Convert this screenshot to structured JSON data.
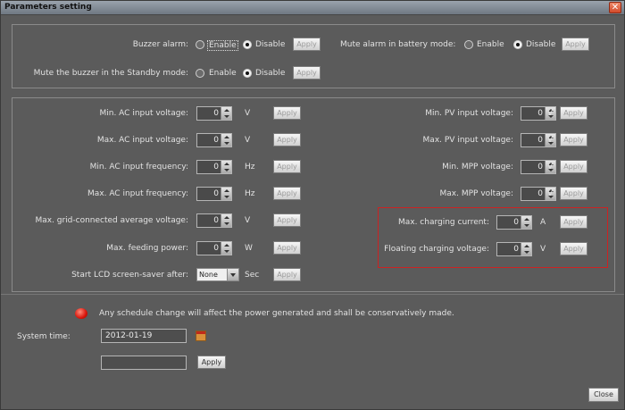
{
  "window": {
    "title": "Parameters setting"
  },
  "top": {
    "buzzer_alarm": {
      "label": "Buzzer alarm:",
      "enable": "Enable",
      "disable": "Disable",
      "apply": "Apply",
      "selected": "enable"
    },
    "mute_battery": {
      "label": "Mute alarm in battery mode:",
      "enable": "Enable",
      "disable": "Disable",
      "apply": "Apply",
      "selected": "disable"
    },
    "mute_standby": {
      "label": "Mute the buzzer in the Standby mode:",
      "enable": "Enable",
      "disable": "Disable",
      "apply": "Apply",
      "selected": "disable"
    }
  },
  "params_left": [
    {
      "label": "Min. AC input voltage:",
      "value": "0",
      "unit": "V",
      "apply": "Apply"
    },
    {
      "label": "Max. AC input voltage:",
      "value": "0",
      "unit": "V",
      "apply": "Apply"
    },
    {
      "label": "Min. AC input frequency:",
      "value": "0",
      "unit": "Hz",
      "apply": "Apply"
    },
    {
      "label": "Max. AC input frequency:",
      "value": "0",
      "unit": "Hz",
      "apply": "Apply"
    },
    {
      "label": "Max. grid-connected average voltage:",
      "value": "0",
      "unit": "V",
      "apply": "Apply"
    },
    {
      "label": "Max. feeding power:",
      "value": "0",
      "unit": "W",
      "apply": "Apply"
    }
  ],
  "params_right": [
    {
      "label": "Min. PV input voltage:",
      "value": "0",
      "unit": "V",
      "apply": "Apply"
    },
    {
      "label": "Max. PV input voltage:",
      "value": "0",
      "unit": "V",
      "apply": "Apply"
    },
    {
      "label": "Min. MPP voltage:",
      "value": "0",
      "unit": "V",
      "apply": "Apply"
    },
    {
      "label": "Max. MPP voltage:",
      "value": "0",
      "unit": "V",
      "apply": "Apply"
    },
    {
      "label": "Max. charging current:",
      "value": "0",
      "unit": "A",
      "apply": "Apply"
    },
    {
      "label": "Floating charging voltage:",
      "value": "0",
      "unit": "V",
      "apply": "Apply"
    }
  ],
  "screensaver": {
    "label": "Start LCD screen-saver after:",
    "value": "None",
    "unit": "Sec",
    "apply": "Apply"
  },
  "schedule": {
    "warning": "Any schedule change will affect the power generated and shall be conservatively made.",
    "system_time_label": "System time:",
    "system_time_value": "2012-01-19",
    "apply": "Apply"
  },
  "footer": {
    "close": "Close"
  },
  "colors": {
    "highlight_box": "#cc2222",
    "warning_icon": "#d9140a"
  }
}
